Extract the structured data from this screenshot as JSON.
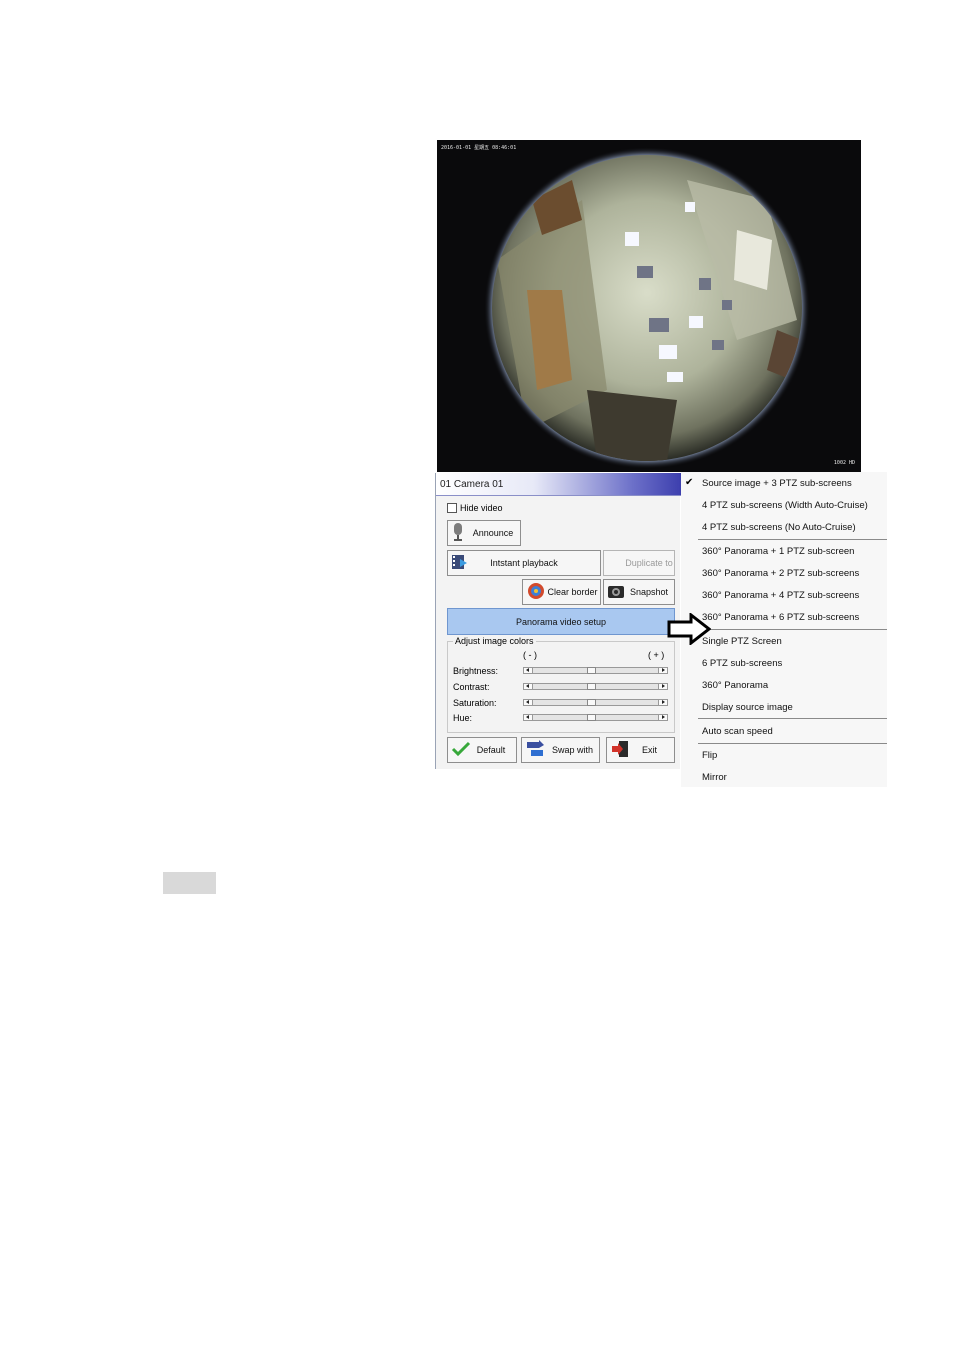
{
  "camera": {
    "osd_top_left": "2016-01-01 星期五 08:46:01",
    "osd_bottom_right": "1002 HD"
  },
  "panel": {
    "title": "01 Camera 01",
    "hide_video": "Hide video",
    "announce": "Announce",
    "instant_playback": "Intstant playback",
    "duplicate_to": "Duplicate to",
    "clear_border": "Clear border",
    "snapshot": "Snapshot",
    "panorama_setup": "Panorama video setup",
    "adjust_colors": "Adjust image colors",
    "minus": "( - )",
    "plus": "( + )",
    "sliders": [
      {
        "label": "Brightness:",
        "value": 0.5
      },
      {
        "label": "Contrast:",
        "value": 0.5
      },
      {
        "label": "Saturation:",
        "value": 0.5
      },
      {
        "label": "Hue:",
        "value": 0.5
      }
    ],
    "default": "Default",
    "swap_with": "Swap with",
    "exit": "Exit"
  },
  "menu": {
    "checked_mark": "✔",
    "items": [
      "Source image + 3 PTZ sub-screens",
      "4 PTZ sub-screens (Width Auto-Cruise)",
      "4 PTZ sub-screens (No Auto-Cruise)",
      "360° Panorama + 1 PTZ sub-screen",
      "360° Panorama + 2 PTZ sub-screens",
      "360° Panorama + 4 PTZ sub-screens",
      "360° Panorama + 6 PTZ sub-screens",
      "Single PTZ Screen",
      "6 PTZ sub-screens",
      "360° Panorama",
      "Display source image",
      "Auto scan speed",
      "Flip",
      "Mirror"
    ]
  }
}
